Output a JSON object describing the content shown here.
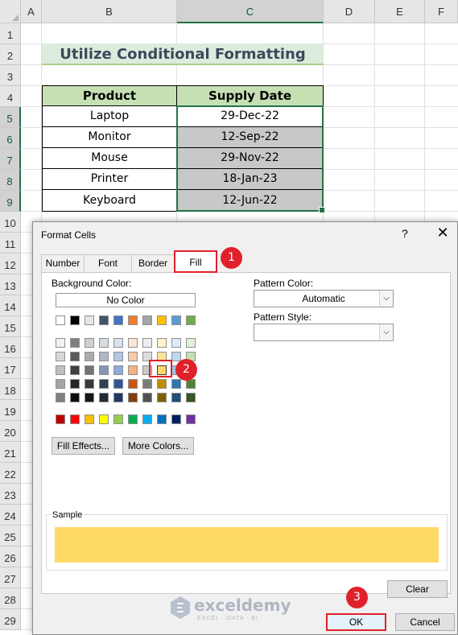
{
  "sheet": {
    "columns": [
      "A",
      "B",
      "C",
      "D",
      "E",
      "F"
    ],
    "rows": [
      "1",
      "2",
      "3",
      "4",
      "5",
      "6",
      "7",
      "8",
      "9",
      "10",
      "11",
      "12",
      "13",
      "14",
      "15",
      "16",
      "17",
      "18",
      "19",
      "20",
      "21",
      "22",
      "23",
      "24",
      "25",
      "26",
      "27",
      "28",
      "29"
    ],
    "title": "Utilize Conditional Formatting",
    "table": {
      "headers": [
        "Product",
        "Supply Date"
      ],
      "rows": [
        [
          "Laptop",
          "29-Dec-22"
        ],
        [
          "Monitor",
          "12-Sep-22"
        ],
        [
          "Mouse",
          "29-Nov-22"
        ],
        [
          "Printer",
          "18-Jan-23"
        ],
        [
          "Keyboard",
          "12-Jun-22"
        ]
      ]
    },
    "colors": {
      "header_fill": "#c6e0b4",
      "highlight_fill": "#c8c8c8",
      "selection": "#217346"
    }
  },
  "dialog": {
    "title": "Format Cells",
    "help": "?",
    "close": "✕",
    "tabs": [
      "Number",
      "Font",
      "Border",
      "Fill"
    ],
    "active_tab": "Fill",
    "background_color_label": "Background Color:",
    "no_color_label": "No Color",
    "pattern_color_label": "Pattern Color:",
    "pattern_color_value": "Automatic",
    "pattern_style_label": "Pattern Style:",
    "pattern_style_value": "",
    "fill_effects_label": "Fill Effects...",
    "more_colors_label": "More Colors...",
    "sample_label": "Sample",
    "sample_color": "#ffd966",
    "clear_label": "Clear",
    "ok_label": "OK",
    "cancel_label": "Cancel",
    "palette": {
      "standard_row": [
        "#ffffff",
        "#000000",
        "#e7e6e6",
        "#44546a",
        "#4472c4",
        "#ed7d31",
        "#a5a5a5",
        "#ffc000",
        "#5b9bd5",
        "#70ad47"
      ],
      "shade_rows": [
        [
          "#f2f2f2",
          "#7f7f7f",
          "#d0cece",
          "#d6dce4",
          "#d9e2f3",
          "#fbe5d5",
          "#ededed",
          "#fff2cc",
          "#deebf6",
          "#e2efd9"
        ],
        [
          "#d8d8d8",
          "#595959",
          "#aeabab",
          "#adb9ca",
          "#b4c6e7",
          "#f7cbac",
          "#dbdbdb",
          "#ffe598",
          "#bdd7ee",
          "#c5e0b3"
        ],
        [
          "#bfbfbf",
          "#3f3f3f",
          "#757070",
          "#8496b0",
          "#8eaadb",
          "#f4b183",
          "#c9c9c9",
          "#ffd966",
          "#9cc3e5",
          "#a8d08d"
        ],
        [
          "#a5a5a5",
          "#262626",
          "#3a3838",
          "#323f4f",
          "#2f5496",
          "#c55a11",
          "#7b7b7b",
          "#bf8f00",
          "#2e75b5",
          "#538135"
        ],
        [
          "#7f7f7f",
          "#0c0c0c",
          "#171616",
          "#222a35",
          "#1f3864",
          "#833c0b",
          "#525252",
          "#7f6000",
          "#1e4e79",
          "#375623"
        ]
      ],
      "accent_row": [
        "#c00000",
        "#ff0000",
        "#ffc000",
        "#ffff00",
        "#92d050",
        "#00b050",
        "#00b0f0",
        "#0070c0",
        "#002060",
        "#7030a0"
      ],
      "selected": "#ffd966"
    }
  },
  "callouts": [
    "1",
    "2",
    "3"
  ],
  "watermark": {
    "name": "exceldemy",
    "tagline": "EXCEL · DATA · BI"
  }
}
